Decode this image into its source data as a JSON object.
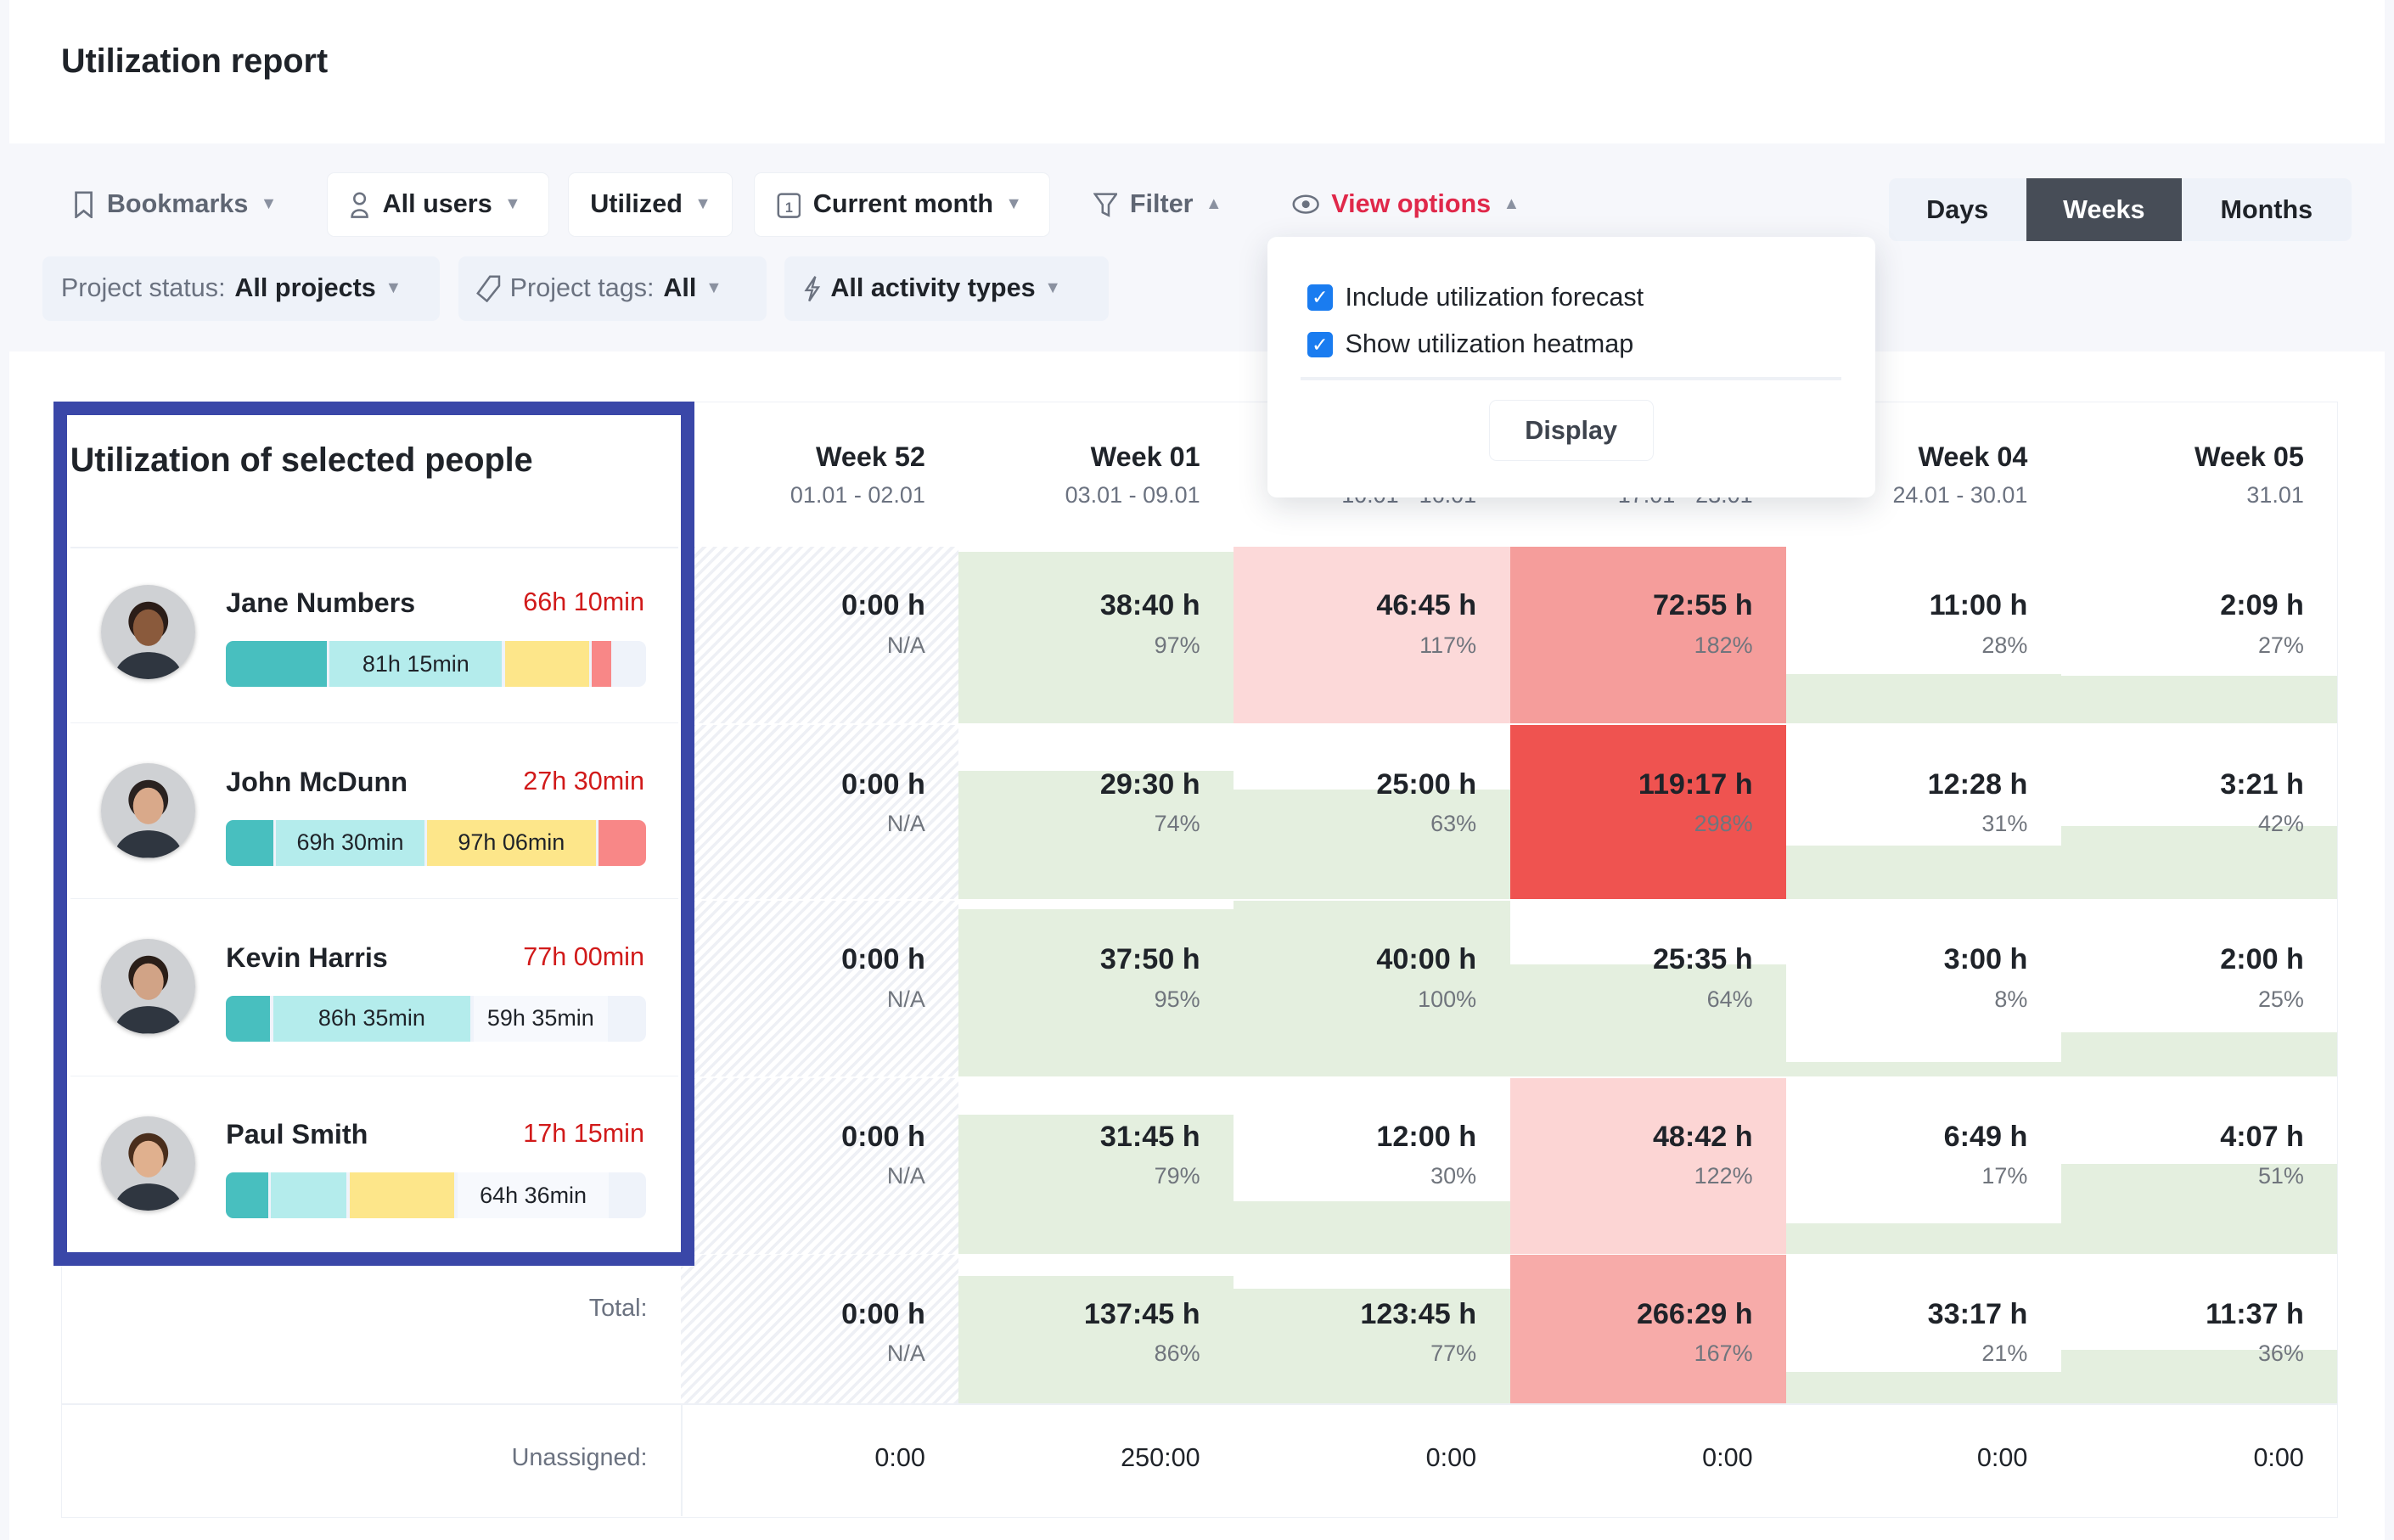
{
  "page_title": "Utilization report",
  "toolbar": {
    "bookmarks": {
      "label": "Bookmarks",
      "icon": "bookmark-icon"
    },
    "users": {
      "label": "All users",
      "icon": "user-icon"
    },
    "mode": {
      "label": "Utilized"
    },
    "period": {
      "label": "Current month",
      "icon": "calendar-icon",
      "icon_text": "1"
    },
    "filter": {
      "label": "Filter",
      "icon": "filter-icon"
    },
    "view_options": {
      "label": "View options",
      "icon": "eye-icon",
      "color": "#e0284a"
    },
    "granularity": {
      "options": [
        "Days",
        "Weeks",
        "Months"
      ],
      "selected": "Weeks"
    }
  },
  "chips": {
    "status": {
      "label": "Project status:",
      "value": "All projects"
    },
    "tags": {
      "label": "Project tags:",
      "value": "All",
      "icon": "tag-icon"
    },
    "activity": {
      "value": "All activity types",
      "icon": "lightning-icon"
    }
  },
  "view_options_dropdown": {
    "options": [
      {
        "label": "Include utilization forecast",
        "checked": true
      },
      {
        "label": "Show utilization heatmap",
        "checked": true
      }
    ],
    "display_button": "Display"
  },
  "people_panel": {
    "title": "Utilization of selected people",
    "highlight_color": "#3a47a8"
  },
  "weeks": [
    {
      "label": "Week 52",
      "dates": "01.01 - 02.01"
    },
    {
      "label": "Week 01",
      "dates": "03.01 - 09.01"
    },
    {
      "label": "",
      "dates": "10.01 - 16.01"
    },
    {
      "label": "",
      "dates": "17.01 - 23.01"
    },
    {
      "label": "Week 04",
      "dates": "24.01 - 30.01"
    },
    {
      "label": "Week 05",
      "dates": "31.01"
    }
  ],
  "people": [
    {
      "name": "Jane Numbers",
      "overtime": "66h 10min",
      "bar": [
        {
          "share": 0.24,
          "color": "#48bfbf",
          "label": ""
        },
        {
          "share": 0.41,
          "color": "#b4ecec",
          "label": "81h 15min"
        },
        {
          "share": 0.2,
          "color": "#fde68a",
          "label": ""
        },
        {
          "share": 0.045,
          "color": "#f88787",
          "label": ""
        }
      ],
      "cells": [
        {
          "hours": "0:00 h",
          "pct": "N/A",
          "value": null
        },
        {
          "hours": "38:40 h",
          "pct": "97%",
          "value": 97
        },
        {
          "hours": "46:45 h",
          "pct": "117%",
          "value": 117
        },
        {
          "hours": "72:55 h",
          "pct": "182%",
          "value": 182
        },
        {
          "hours": "11:00 h",
          "pct": "28%",
          "value": 28
        },
        {
          "hours": "2:09 h",
          "pct": "27%",
          "value": 27
        }
      ]
    },
    {
      "name": "John McDunn",
      "overtime": "27h 30min",
      "bar": [
        {
          "share": 0.115,
          "color": "#48bfbf",
          "label": ""
        },
        {
          "share": 0.36,
          "color": "#b4ecec",
          "label": "69h 30min"
        },
        {
          "share": 0.41,
          "color": "#fde68a",
          "label": "97h 06min"
        },
        {
          "share": 0.115,
          "color": "#f88787",
          "label": ""
        }
      ],
      "cells": [
        {
          "hours": "0:00 h",
          "pct": "N/A",
          "value": null
        },
        {
          "hours": "29:30 h",
          "pct": "74%",
          "value": 74
        },
        {
          "hours": "25:00 h",
          "pct": "63%",
          "value": 63
        },
        {
          "hours": "119:17 h",
          "pct": "298%",
          "value": 298
        },
        {
          "hours": "12:28 h",
          "pct": "31%",
          "value": 31
        },
        {
          "hours": "3:21 h",
          "pct": "42%",
          "value": 42
        }
      ]
    },
    {
      "name": "Kevin Harris",
      "overtime": "77h 00min",
      "bar": [
        {
          "share": 0.105,
          "color": "#48bfbf",
          "label": ""
        },
        {
          "share": 0.47,
          "color": "#b4ecec",
          "label": "86h 35min"
        },
        {
          "share": 0.32,
          "color": "#f7f9fd",
          "label": "59h 35min"
        }
      ],
      "cells": [
        {
          "hours": "0:00 h",
          "pct": "N/A",
          "value": null
        },
        {
          "hours": "37:50 h",
          "pct": "95%",
          "value": 95
        },
        {
          "hours": "40:00 h",
          "pct": "100%",
          "value": 100
        },
        {
          "hours": "25:35 h",
          "pct": "64%",
          "value": 64
        },
        {
          "hours": "3:00 h",
          "pct": "8%",
          "value": 8
        },
        {
          "hours": "2:00 h",
          "pct": "25%",
          "value": 25
        }
      ]
    },
    {
      "name": "Paul Smith",
      "overtime": "17h 15min",
      "bar": [
        {
          "share": 0.1,
          "color": "#48bfbf",
          "label": ""
        },
        {
          "share": 0.18,
          "color": "#b4ecec",
          "label": ""
        },
        {
          "share": 0.25,
          "color": "#fde68a",
          "label": ""
        },
        {
          "share": 0.36,
          "color": "#f7f9fd",
          "label": "64h 36min"
        }
      ],
      "cells": [
        {
          "hours": "0:00 h",
          "pct": "N/A",
          "value": null
        },
        {
          "hours": "31:45 h",
          "pct": "79%",
          "value": 79
        },
        {
          "hours": "12:00 h",
          "pct": "30%",
          "value": 30
        },
        {
          "hours": "48:42 h",
          "pct": "122%",
          "value": 122
        },
        {
          "hours": "6:49 h",
          "pct": "17%",
          "value": 17
        },
        {
          "hours": "4:07 h",
          "pct": "51%",
          "value": 51
        }
      ]
    }
  ],
  "total": {
    "label": "Total:",
    "cells": [
      {
        "hours": "0:00 h",
        "pct": "N/A",
        "value": null
      },
      {
        "hours": "137:45 h",
        "pct": "86%",
        "value": 86
      },
      {
        "hours": "123:45 h",
        "pct": "77%",
        "value": 77
      },
      {
        "hours": "266:29 h",
        "pct": "167%",
        "value": 167
      },
      {
        "hours": "33:17 h",
        "pct": "21%",
        "value": 21
      },
      {
        "hours": "11:37 h",
        "pct": "36%",
        "value": 36
      }
    ]
  },
  "unassigned": {
    "label": "Unassigned:",
    "values": [
      "0:00",
      "250:00",
      "0:00",
      "0:00",
      "0:00",
      "0:00"
    ]
  },
  "heatmap_colors": {
    "under": "#e4efdf",
    "over_low": "#fde0e0",
    "over_high": "#ef5350"
  }
}
